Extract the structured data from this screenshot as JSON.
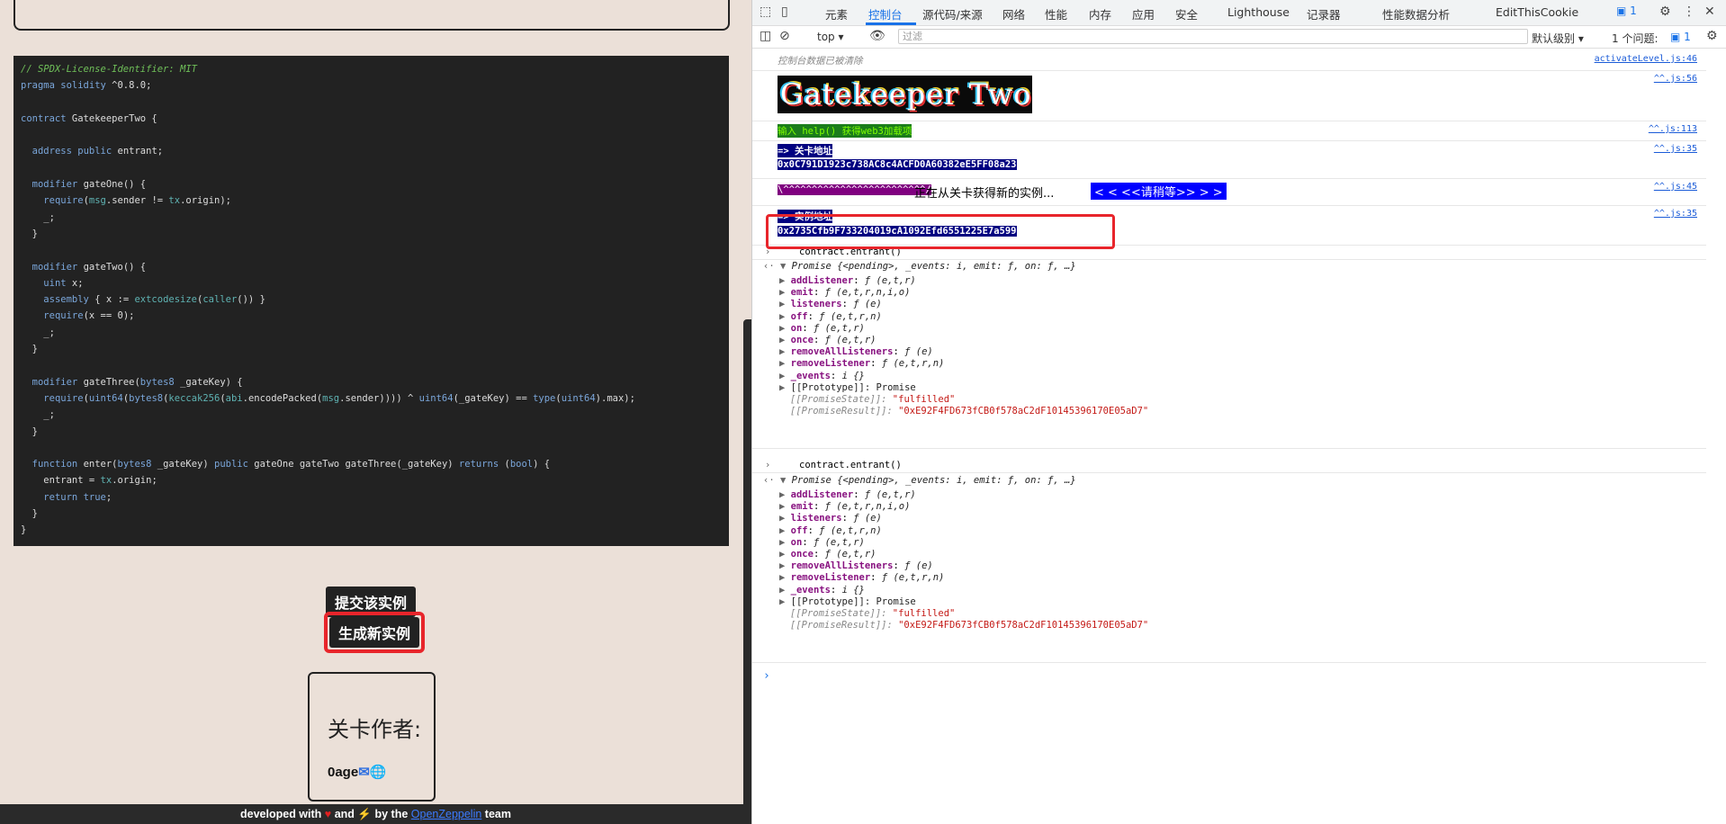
{
  "page": {
    "code_lines": [
      "// SPDX-License-Identifier: MIT",
      "pragma solidity ^0.8.0;",
      "",
      "contract GatekeeperTwo {",
      "",
      "  address public entrant;",
      "",
      "  modifier gateOne() {",
      "    require(msg.sender != tx.origin);",
      "    _;",
      "  }",
      "",
      "  modifier gateTwo() {",
      "    uint x;",
      "    assembly { x := extcodesize(caller()) }",
      "    require(x == 0);",
      "    _;",
      "  }",
      "",
      "  modifier gateThree(bytes8 _gateKey) {",
      "    require(uint64(bytes8(keccak256(abi.encodePacked(msg.sender)))) ^ uint64(_gateKey) == type(uint64).max);",
      "    _;",
      "  }",
      "",
      "  function enter(bytes8 _gateKey) public gateOne gateTwo gateThree(_gateKey) returns (bool) {",
      "    entrant = tx.origin;",
      "    return true;",
      "  }",
      "}"
    ],
    "submit_button": "提交该实例",
    "new_instance_button": "生成新实例",
    "author_title": "关卡作者:",
    "author_name": "0age",
    "footer": {
      "pre": "developed with",
      "and": "and",
      "by_the": "by the",
      "link": "OpenZeppelin",
      "post": "team"
    }
  },
  "devtools": {
    "tabs": [
      "元素",
      "控制台",
      "源代码/来源",
      "网络",
      "性能",
      "内存",
      "应用",
      "安全",
      "Lighthouse",
      "记录器",
      "性能数据分析",
      "EditThisCookie"
    ],
    "active_tab": "控制台",
    "message_badge": "1",
    "context": "top",
    "filter_placeholder": "过滤",
    "levels": "默认级别",
    "issues": "1 个问题:",
    "issues_count": "1",
    "console": {
      "cleared": "控制台数据已被清除",
      "cleared_src": "activateLevel.js:46",
      "banner": "Gatekeeper Two",
      "banner_src": "^^.js:56",
      "help": "输入 help() 获得web3加载项",
      "help_src": "^^.js:113",
      "level_label": "=> 关卡地址",
      "level_address": "0x0C791D1923c738AC8c4ACFD0A60382eE5FF08a23",
      "level_src": "^^.js:35",
      "loading_prefix": "\\^^^^^^^^^^^^^^^^^^^^^^^^^/",
      "loading_text": "正在从关卡获得新的实例...",
      "loading_wait": "< < <<请稍等>> > >",
      "loading_src": "^^.js:45",
      "instance_label": "=> 实例地址",
      "instance_address": "0x2735Cfb9F733204019cA1092Efd6551225E7a599",
      "instance_src": "^^.js:35",
      "command": "contract.entrant()",
      "promise_header": "Promise {<pending>, _events: i, emit: ƒ, on: ƒ, …}",
      "promise_props": [
        {
          "name": "addListener",
          "sig": "ƒ (e,t,r)"
        },
        {
          "name": "emit",
          "sig": "ƒ (e,t,r,n,i,o)"
        },
        {
          "name": "listeners",
          "sig": "ƒ (e)"
        },
        {
          "name": "off",
          "sig": "ƒ (e,t,r,n)"
        },
        {
          "name": "on",
          "sig": "ƒ (e,t,r)"
        },
        {
          "name": "once",
          "sig": "ƒ (e,t,r)"
        },
        {
          "name": "removeAllListeners",
          "sig": "ƒ (e)"
        },
        {
          "name": "removeListener",
          "sig": "ƒ (e,t,r,n)"
        },
        {
          "name": "_events",
          "sig": "i {}"
        }
      ],
      "prototype": "[[Prototype]]: Promise",
      "promise_state_label": "[[PromiseState]]:",
      "promise_state": "\"fulfilled\"",
      "promise_result_label": "[[PromiseResult]]:",
      "promise_result": "\"0xE92F4FD673fCB0f578aC2dF10145396170E05aD7\""
    }
  }
}
